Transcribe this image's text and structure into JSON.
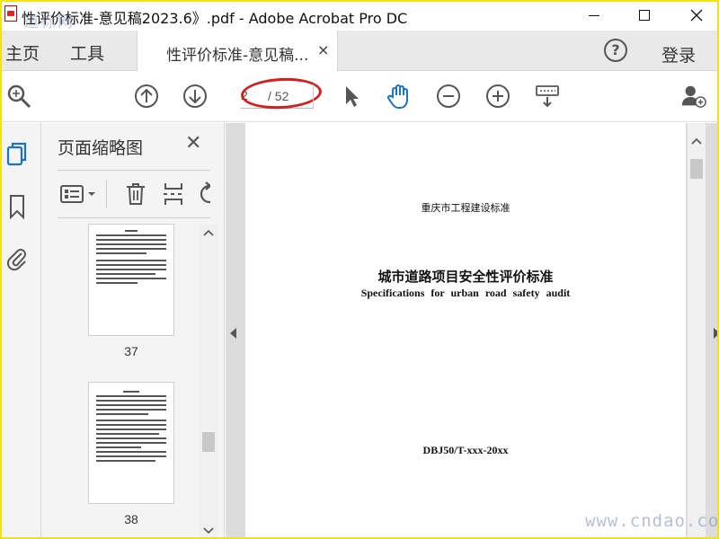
{
  "window": {
    "title": "性评价标准-意见稿2023.6》.pdf - Adobe Acrobat Pro DC",
    "watermark_left": "道标网"
  },
  "tabbar": {
    "home": "主页",
    "tools": "工具",
    "doc_tab": "性评价标准-意见稿...",
    "close_glyph": "×",
    "help_glyph": "?",
    "login": "登录"
  },
  "toolbar": {
    "current_page": "2",
    "total_pages": "/ 52"
  },
  "thumbnails": {
    "title": "页面缩略图",
    "close_glyph": "✕",
    "pages": [
      {
        "label": "37"
      },
      {
        "label": "38"
      }
    ]
  },
  "document": {
    "org": "重庆市工程建设标准",
    "title": "城市道路项目安全性评价标准",
    "subtitle": "Specifications for urban road safety audit",
    "code": "DBJ50/T-xxx-20xx"
  },
  "watermark_right": "www.cndao.com",
  "colors": {
    "accent": "#1a73c8",
    "annotation": "#d51f1f",
    "frame": "#f2e21a"
  }
}
